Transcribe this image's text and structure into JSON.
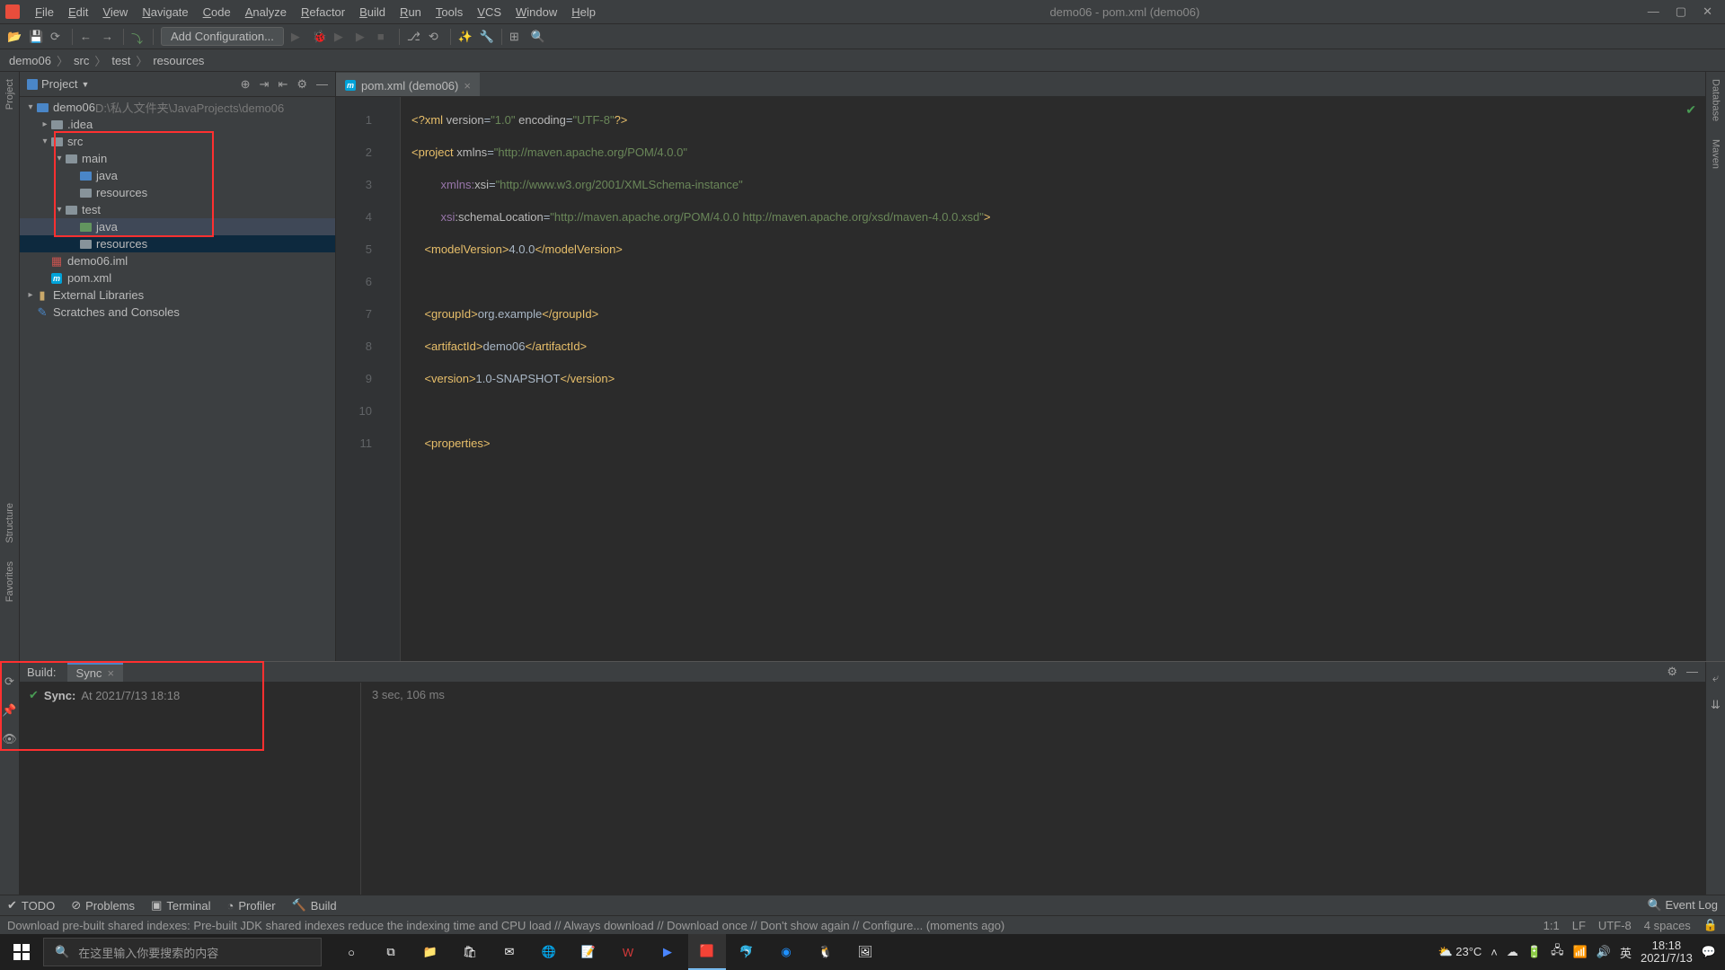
{
  "window": {
    "title": "demo06 - pom.xml (demo06)"
  },
  "menu": [
    "File",
    "Edit",
    "View",
    "Navigate",
    "Code",
    "Analyze",
    "Refactor",
    "Build",
    "Run",
    "Tools",
    "VCS",
    "Window",
    "Help"
  ],
  "toolbar": {
    "run_config": "Add Configuration..."
  },
  "breadcrumb": [
    "demo06",
    "src",
    "test",
    "resources"
  ],
  "project_panel": {
    "title": "Project",
    "root": {
      "name": "demo06",
      "path": "D:\\私人文件夹\\JavaProjects\\demo06"
    },
    "tree": [
      {
        "depth": 0,
        "expand": "v",
        "icon": "module",
        "label": "demo06",
        "suffix": "D:\\私人文件夹\\JavaProjects\\demo06"
      },
      {
        "depth": 1,
        "expand": ">",
        "icon": "folder",
        "label": ".idea"
      },
      {
        "depth": 1,
        "expand": "v",
        "icon": "folder",
        "label": "src"
      },
      {
        "depth": 2,
        "expand": "v",
        "icon": "folder",
        "label": "main"
      },
      {
        "depth": 3,
        "expand": "",
        "icon": "folder-blue",
        "label": "java"
      },
      {
        "depth": 3,
        "expand": "",
        "icon": "folder-res",
        "label": "resources"
      },
      {
        "depth": 2,
        "expand": "v",
        "icon": "folder",
        "label": "test"
      },
      {
        "depth": 3,
        "expand": "",
        "icon": "folder-green",
        "label": "java",
        "hov": true
      },
      {
        "depth": 3,
        "expand": "",
        "icon": "folder-res",
        "label": "resources",
        "sel": true
      },
      {
        "depth": 1,
        "expand": "",
        "icon": "iml",
        "label": "demo06.iml"
      },
      {
        "depth": 1,
        "expand": "",
        "icon": "maven",
        "label": "pom.xml"
      },
      {
        "depth": 0,
        "expand": ">",
        "icon": "lib",
        "label": "External Libraries"
      },
      {
        "depth": 0,
        "expand": "",
        "icon": "scratch",
        "label": "Scratches and Consoles"
      }
    ]
  },
  "editor_tab": {
    "label": "pom.xml (demo06)"
  },
  "code": {
    "lines": [
      {
        "n": 1,
        "html": "<span class='pi'>&lt;?</span><span class='tag'>xml </span><span class='attr'>version</span>=<span class='str'>\"1.0\"</span> <span class='attr'>encoding</span>=<span class='str'>\"UTF-8\"</span><span class='pi'>?&gt;</span>"
      },
      {
        "n": 2,
        "html": "<span class='tag'>&lt;project </span><span class='attr'>xmlns</span>=<span class='str'>\"http://maven.apache.org/POM/4.0.0\"</span>"
      },
      {
        "n": 3,
        "html": "         <span class='ns'>xmlns:</span><span class='attr'>xsi</span>=<span class='str'>\"http://www.w3.org/2001/XMLSchema-instance\"</span>"
      },
      {
        "n": 4,
        "html": "         <span class='ns'>xsi</span><span class='attr'>:schemaLocation</span>=<span class='str'>\"http://maven.apache.org/POM/4.0.0 http://maven.apache.org/xsd/maven-4.0.0.xsd\"</span><span class='tag'>&gt;</span>"
      },
      {
        "n": 5,
        "html": "    <span class='tag'>&lt;modelVersion&gt;</span>4.0.0<span class='tag'>&lt;/modelVersion&gt;</span>"
      },
      {
        "n": 6,
        "html": ""
      },
      {
        "n": 7,
        "html": "    <span class='tag'>&lt;groupId&gt;</span>org.example<span class='tag'>&lt;/groupId&gt;</span>"
      },
      {
        "n": 8,
        "html": "    <span class='tag'>&lt;artifactId&gt;</span>demo06<span class='tag'>&lt;/artifactId&gt;</span>"
      },
      {
        "n": 9,
        "html": "    <span class='tag'>&lt;version&gt;</span>1.0-SNAPSHOT<span class='tag'>&lt;/version&gt;</span>"
      },
      {
        "n": 10,
        "html": ""
      },
      {
        "n": 11,
        "html": "    <span class='tag'>&lt;properties&gt;</span>"
      }
    ]
  },
  "build": {
    "label": "Build:",
    "tab": "Sync",
    "sync_label": "Sync:",
    "sync_time": "At 2021/7/13 18:18",
    "duration": "3 sec, 106 ms"
  },
  "bottom_tools": [
    "TODO",
    "Problems",
    "Terminal",
    "Profiler",
    "Build"
  ],
  "bottom_right": "Event Log",
  "status": {
    "msg": "Download pre-built shared indexes: Pre-built JDK shared indexes reduce the indexing time and CPU load // Always download // Download once // Don't show again // Configure... (moments ago)",
    "pos": "1:1",
    "le": "LF",
    "enc": "UTF-8",
    "indent": "4 spaces"
  },
  "left_tabs": [
    "Project"
  ],
  "left_tabs2": [
    "Structure",
    "Favorites"
  ],
  "right_tabs": [
    "Database",
    "Maven"
  ],
  "taskbar": {
    "search_placeholder": "在这里输入你要搜索的内容",
    "weather": "23°C",
    "ime": "英",
    "time": "18:18",
    "date": "2021/7/13"
  }
}
